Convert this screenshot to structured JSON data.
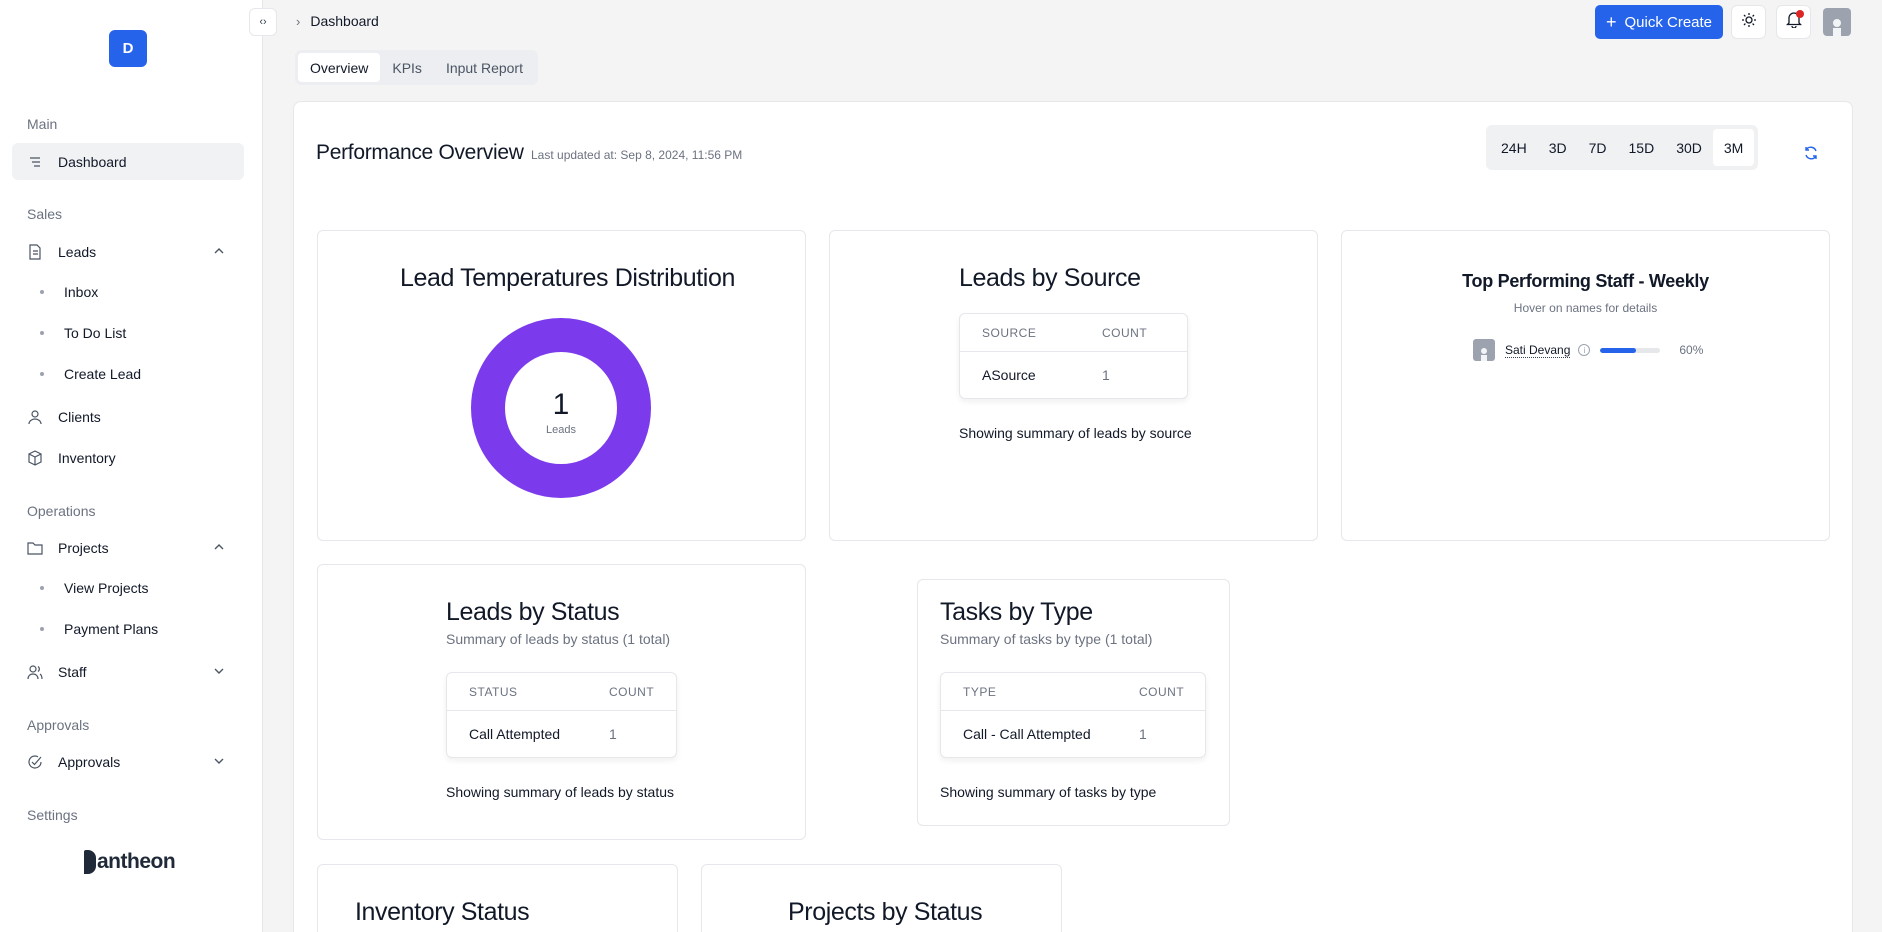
{
  "sidebar": {
    "logo_letter": "D",
    "sections": {
      "main": "Main",
      "sales": "Sales",
      "operations": "Operations",
      "approvals": "Approvals",
      "settings": "Settings"
    },
    "items": {
      "dashboard": "Dashboard",
      "leads": "Leads",
      "inbox": "Inbox",
      "todo": "To Do List",
      "create_lead": "Create Lead",
      "clients": "Clients",
      "inventory": "Inventory",
      "projects": "Projects",
      "view_projects": "View Projects",
      "payment_plans": "Payment Plans",
      "staff": "Staff",
      "approvals": "Approvals"
    },
    "brand": "antheon"
  },
  "header": {
    "breadcrumb": "Dashboard",
    "quick_create": "Quick Create",
    "accent": "#2563eb"
  },
  "tabs": [
    "Overview",
    "KPIs",
    "Input Report"
  ],
  "performance": {
    "title": "Performance Overview",
    "last_updated": "Last updated at: Sep 8, 2024, 11:56 PM",
    "ranges": [
      "24H",
      "3D",
      "7D",
      "15D",
      "30D",
      "3M"
    ],
    "active_range": "3M"
  },
  "lead_temps": {
    "title": "Lead Temperatures Distribution",
    "total": "1",
    "total_label": "Leads",
    "color": "#7c3aed"
  },
  "leads_by_source": {
    "title": "Leads by Source",
    "col_source": "SOURCE",
    "col_count": "COUNT",
    "rows": [
      {
        "source": "ASource",
        "count": "1"
      }
    ],
    "footer": "Showing summary of leads by source"
  },
  "top_staff": {
    "title": "Top Performing Staff - Weekly",
    "subtitle": "Hover on names for details",
    "staff": [
      {
        "name": "Sati Devang",
        "percent": "60%",
        "fraction": 0.6
      }
    ]
  },
  "leads_by_status": {
    "title": "Leads by Status",
    "subtitle": "Summary of leads by status (1 total)",
    "col_status": "STATUS",
    "col_count": "COUNT",
    "rows": [
      {
        "status": "Call Attempted",
        "count": "1"
      }
    ],
    "footer": "Showing summary of leads by status"
  },
  "tasks_by_type": {
    "title": "Tasks by Type",
    "subtitle": "Summary of tasks by type (1 total)",
    "col_type": "TYPE",
    "col_count": "COUNT",
    "rows": [
      {
        "type": "Call - Call Attempted",
        "count": "1"
      }
    ],
    "footer": "Showing summary of tasks by type"
  },
  "inventory_status": {
    "title": "Inventory Status"
  },
  "projects_by_status": {
    "title": "Projects by Status"
  }
}
